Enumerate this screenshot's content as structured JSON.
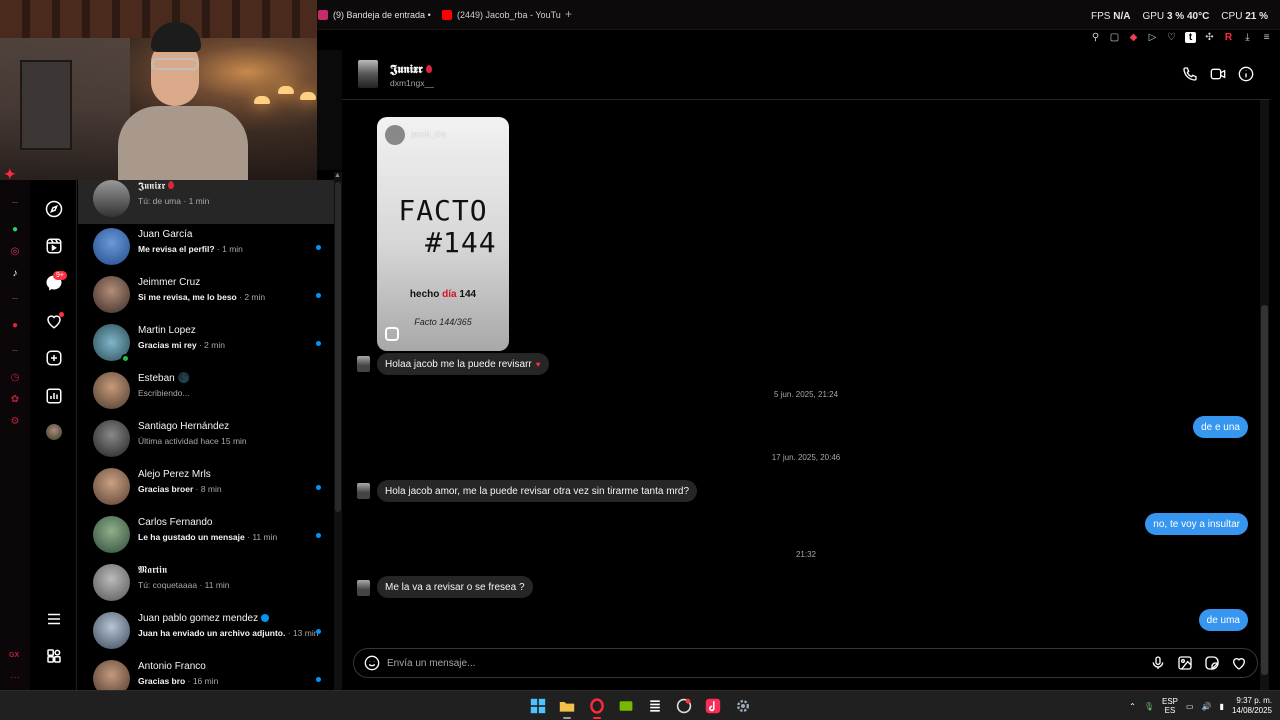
{
  "browser": {
    "tabs": [
      {
        "label": "(9) Bandeja de entrada •",
        "active": true
      },
      {
        "label": "(2449) Jacob_rba - YouTu",
        "active": false
      }
    ],
    "new_tab_icon": "plus-icon",
    "perf": {
      "fps_label": "FPS",
      "fps_value": "N/A",
      "gpu_label": "GPU",
      "gpu_load": "3 %",
      "gpu_temp": "40°C",
      "cpu_label": "CPU",
      "cpu_load": "21 %"
    }
  },
  "chat": {
    "contact_name": "𝕵𝖚𝖓𝖎𝖝𝖗",
    "contact_username": "dxm1ngx__",
    "shared_reel": {
      "author": "jacob_rba",
      "title_line1": "FACTO",
      "title_line2": "#144",
      "caption_a": "hecho",
      "caption_b": "día",
      "caption_c": "144",
      "signature": "Facto 144/365"
    },
    "messages": [
      {
        "kind": "in",
        "text": "Holaa jacob me la puede revisarr",
        "reaction": "♥"
      },
      {
        "kind": "stamp",
        "text": "5 jun. 2025, 21:24"
      },
      {
        "kind": "out",
        "text": "de e una"
      },
      {
        "kind": "stamp",
        "text": "17 jun. 2025, 20:46"
      },
      {
        "kind": "in",
        "text": "Hola jacob amor, me la puede revisar otra vez sin tirarme tanta mrd?"
      },
      {
        "kind": "out",
        "text": "no, te voy a insultar"
      },
      {
        "kind": "stamp",
        "text": "21:32"
      },
      {
        "kind": "in",
        "text": "Me la va a revisar o se fresea ?"
      },
      {
        "kind": "out",
        "text": "de uma"
      }
    ],
    "composer_placeholder": "Envía un mensaje..."
  },
  "conversations": [
    {
      "name": "𝕵𝖚𝖓𝖎𝖝𝖗",
      "preview": "Tú: de uma",
      "time": "1 min",
      "unread": false,
      "selected": true
    },
    {
      "name": "Juan García",
      "preview": "Me revisa el perfil?",
      "time": "1 min",
      "unread": true
    },
    {
      "name": "Jeimmer Cruz",
      "preview": "Si me revisa, me lo beso",
      "time": "2 min",
      "unread": true
    },
    {
      "name": "Martin Lopez",
      "preview": "Gracias mi rey",
      "time": "2 min",
      "unread": true,
      "online": true
    },
    {
      "name": "Esteban 🌑",
      "preview": "Escribiendo...",
      "time": "",
      "unread": false
    },
    {
      "name": "Santiago Hernández",
      "preview": "Última actividad hace 15 min",
      "time": "",
      "unread": false
    },
    {
      "name": "Alejo Perez Mrls",
      "preview": "Gracias broer",
      "time": "8 min",
      "unread": true
    },
    {
      "name": "Carlos Fernando",
      "preview": "Le ha gustado un mensaje",
      "time": "11 min",
      "unread": true
    },
    {
      "name": "𝕸𝖆𝖗𝖙𝖎𝖓",
      "preview": "Tú: coquetaaaa",
      "time": "11 min",
      "unread": false
    },
    {
      "name": "Juan pablo gomez mendez",
      "preview": "Juan ha enviado un archivo adjunto.",
      "time": "13 min",
      "unread": true,
      "verified": true
    },
    {
      "name": "Antonio Franco",
      "preview": "Gracias bro",
      "time": "16 min",
      "unread": true
    }
  ],
  "nav_badge": "9+",
  "taskbar": {
    "lang_top": "ESP",
    "lang_bottom": "ES",
    "time": "9:37 p. m.",
    "date": "14/08/2025"
  },
  "colors": {
    "accent_blue": "#3797f0",
    "unread_dot": "#0095f6",
    "opera_red": "#ff2a3b",
    "incoming_bubble": "#262626"
  }
}
